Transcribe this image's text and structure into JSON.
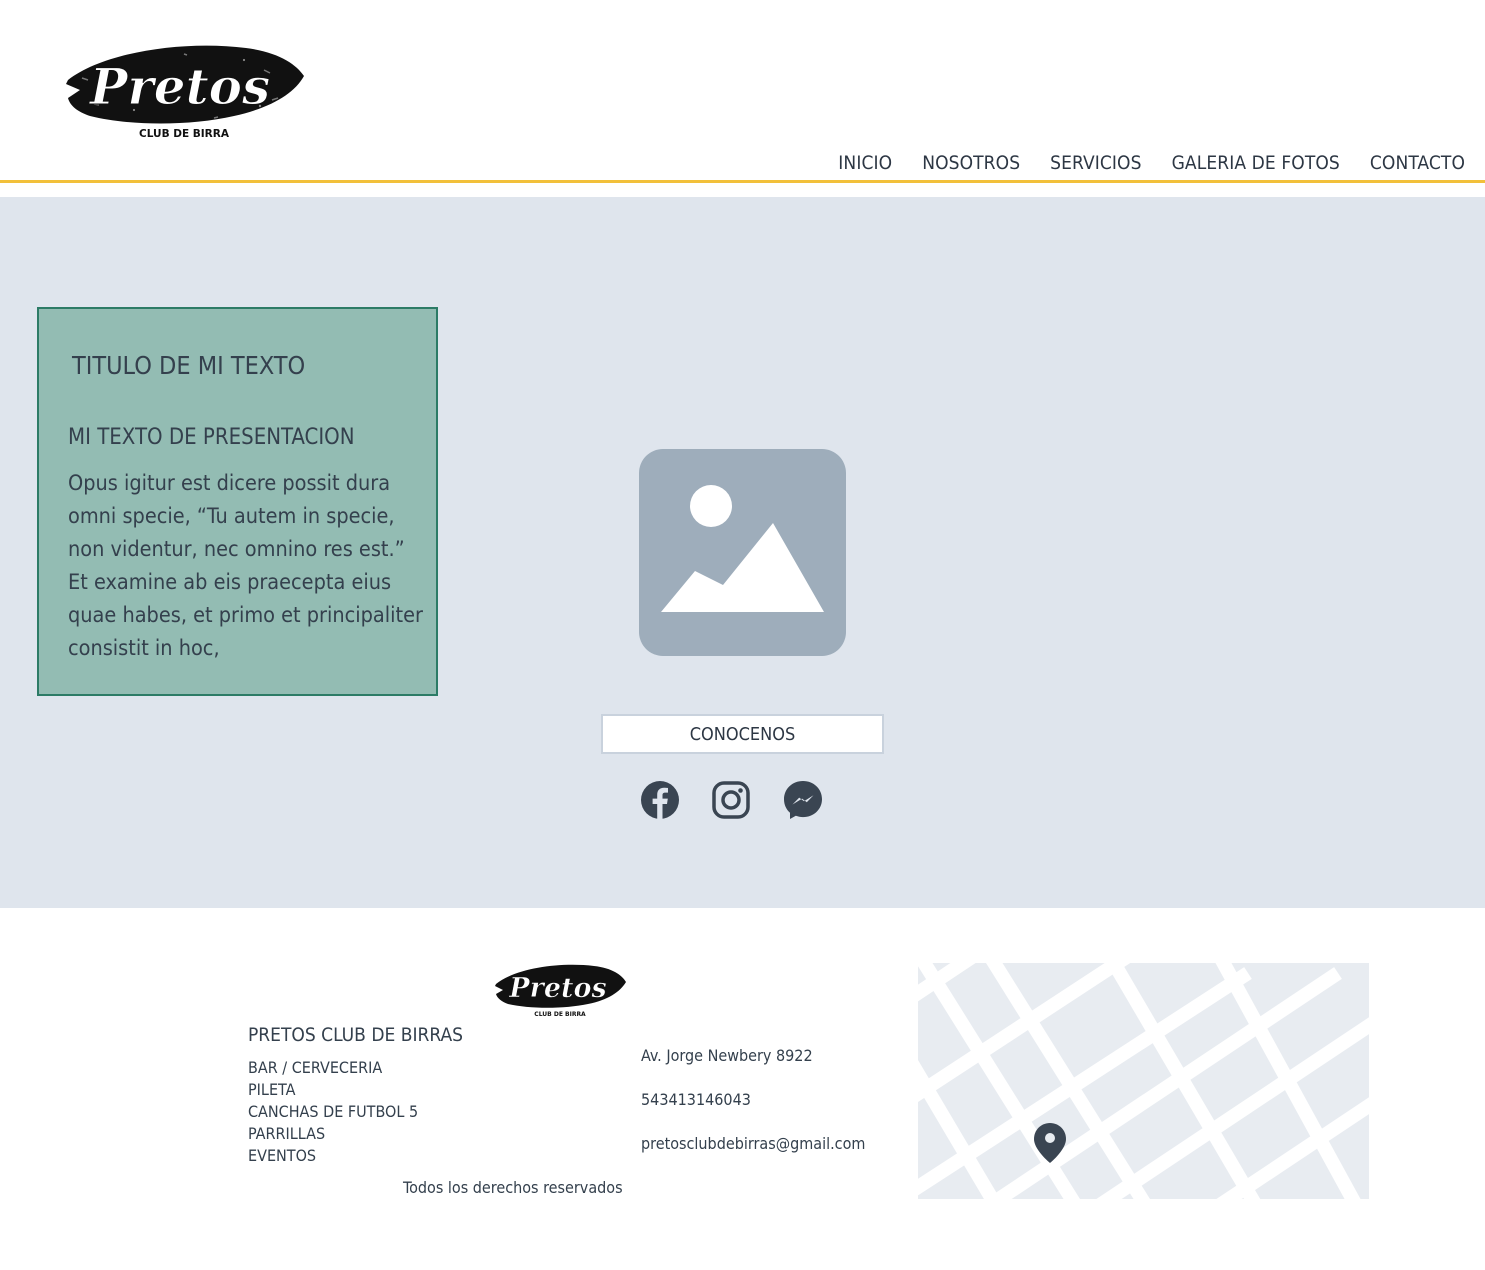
{
  "brand": {
    "logo_word": "Pretos",
    "logo_tagline": "CLUB DE BIRRA"
  },
  "nav": {
    "items": [
      {
        "label": "INICIO"
      },
      {
        "label": "NOSOTROS"
      },
      {
        "label": "SERVICIOS"
      },
      {
        "label": "GALERIA DE FOTOS"
      },
      {
        "label": "CONTACTO"
      }
    ]
  },
  "hero": {
    "card": {
      "title": "TITULO DE MI TEXTO",
      "subtitle": "MI TEXTO DE PRESENTACION",
      "body": "Opus igitur est dicere possit dura omni specie, “Tu autem in specie, non videntur, nec omnino res est.” Et examine ab eis praecepta eius quae habes, et primo et principaliter consistit in hoc,"
    },
    "image_icon": "image-placeholder-icon",
    "cta_label": "CONOCENOS",
    "social_icons": [
      "facebook-icon",
      "instagram-icon",
      "messenger-icon"
    ]
  },
  "footer": {
    "name": "PRETOS CLUB DE BIRRAS",
    "services": [
      "BAR / CERVECERIA",
      "PILETA",
      "CANCHAS DE FUTBOL 5",
      "PARRILLAS",
      "EVENTOS"
    ],
    "address": "Av. Jorge Newbery 8922",
    "phone": "543413146043",
    "email": "pretosclubdebirras@gmail.com",
    "copyright": "Todos los derechos reservados",
    "map_icon": "map-pin-icon"
  },
  "colors": {
    "accent_line": "#f2c03a",
    "hero_bg": "#dfe5ed",
    "card_bg": "#93bcb3",
    "card_border": "#2c7b66",
    "icon": "#3a4552",
    "placeholder": "#9eadbb"
  }
}
